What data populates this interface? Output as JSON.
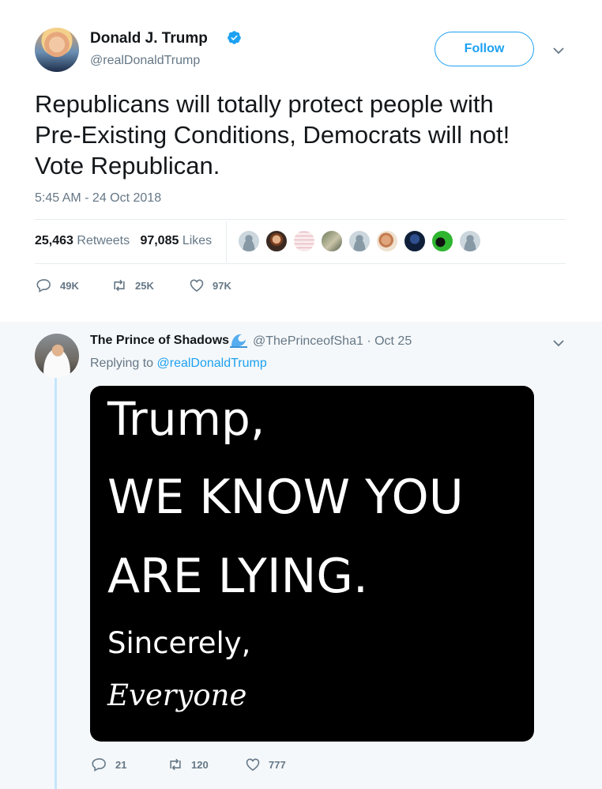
{
  "main_tweet": {
    "display_name": "Donald J. Trump",
    "handle": "@realDonaldTrump",
    "follow_label": "Follow",
    "text_lines": [
      "Republicans will totally protect people with",
      "Pre-Existing Conditions, Democrats will not!",
      "Vote Republican."
    ],
    "timestamp": "5:45 AM - 24 Oct 2018",
    "retweets_count": "25,463",
    "retweets_label": "Retweets",
    "likes_count": "97,085",
    "likes_label": "Likes",
    "actions": {
      "replies": "49K",
      "retweets": "25K",
      "likes": "97K"
    }
  },
  "reply": {
    "display_name": "The Prince of Shadows",
    "handle_date": "@ThePrinceofSha1 · Oct 25",
    "replying_prefix": "Replying to",
    "replying_to": "@realDonaldTrump",
    "media_text": [
      "Trump,",
      "WE KNOW YOU",
      "ARE LYING.",
      "Sincerely,",
      "Everyone"
    ],
    "actions": {
      "replies": "21",
      "retweets": "120",
      "likes": "777"
    }
  },
  "icons": [
    "verified-badge-icon",
    "chevron-down-icon",
    "reply-icon",
    "retweet-icon",
    "like-icon",
    "wave-emoji-icon"
  ],
  "colors": {
    "accent": "#1da1f2",
    "muted": "#657786",
    "text": "#14171a",
    "reply_bg": "#f5f8fa",
    "thread_line": "#c4e5fb"
  }
}
